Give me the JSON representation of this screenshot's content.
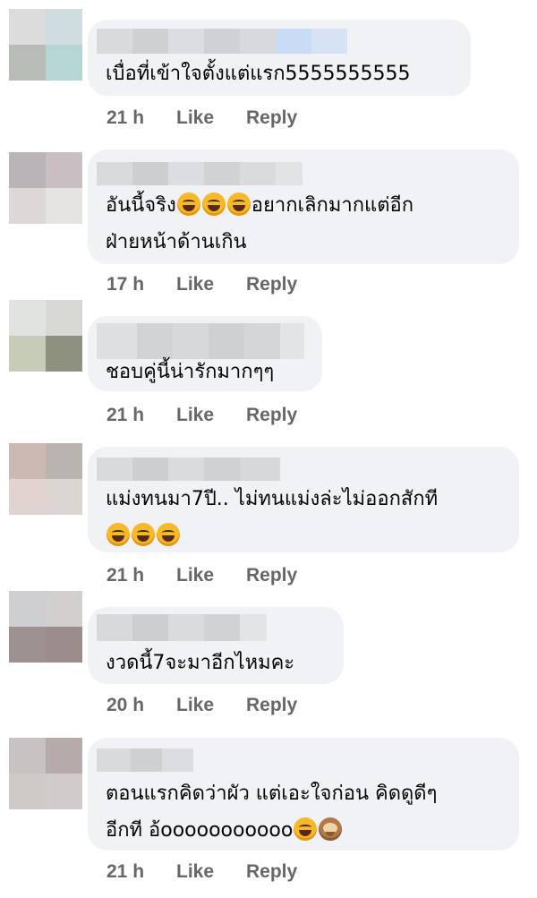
{
  "comments": [
    {
      "text_lines": [
        "เบื่อที่เข้าใจตั้งแต่แรก5555555555"
      ],
      "time": "21 h",
      "like": "Like",
      "reply": "Reply"
    },
    {
      "text_lines": [
        "อันนี้จริง",
        "อยากเลิกมากแต่อีก",
        "ฝ่ายหน้าด้านเกิน"
      ],
      "time": "17 h",
      "like": "Like",
      "reply": "Reply"
    },
    {
      "text_lines": [
        "ชอบคู่นี้น่ารักมากๆๆ"
      ],
      "time": "21 h",
      "like": "Like",
      "reply": "Reply"
    },
    {
      "text_lines": [
        "แม่งทนมา7ปี.. ไม่ทนแม่งล่ะไม่ออกสักที"
      ],
      "time": "21 h",
      "like": "Like",
      "reply": "Reply"
    },
    {
      "text_lines": [
        "งวดนี้7จะมาอีกไหมคะ"
      ],
      "time": "20 h",
      "like": "Like",
      "reply": "Reply"
    },
    {
      "text_lines": [
        "ตอนแรกคิดว่าผัว แต่เอะใจก่อน คิดดูดีๆ",
        "อีกที อ้ooooooooooo"
      ],
      "time": "21 h",
      "like": "Like",
      "reply": "Reply"
    }
  ],
  "emoji": {
    "laugh": "rolling-on-floor-laughing-icon",
    "joy": "tears-of-joy-icon",
    "monkey": "see-no-evil-monkey-icon"
  },
  "colors": {
    "bubble": "#f0f2f5",
    "meta": "#65676b",
    "text": "#050505"
  }
}
